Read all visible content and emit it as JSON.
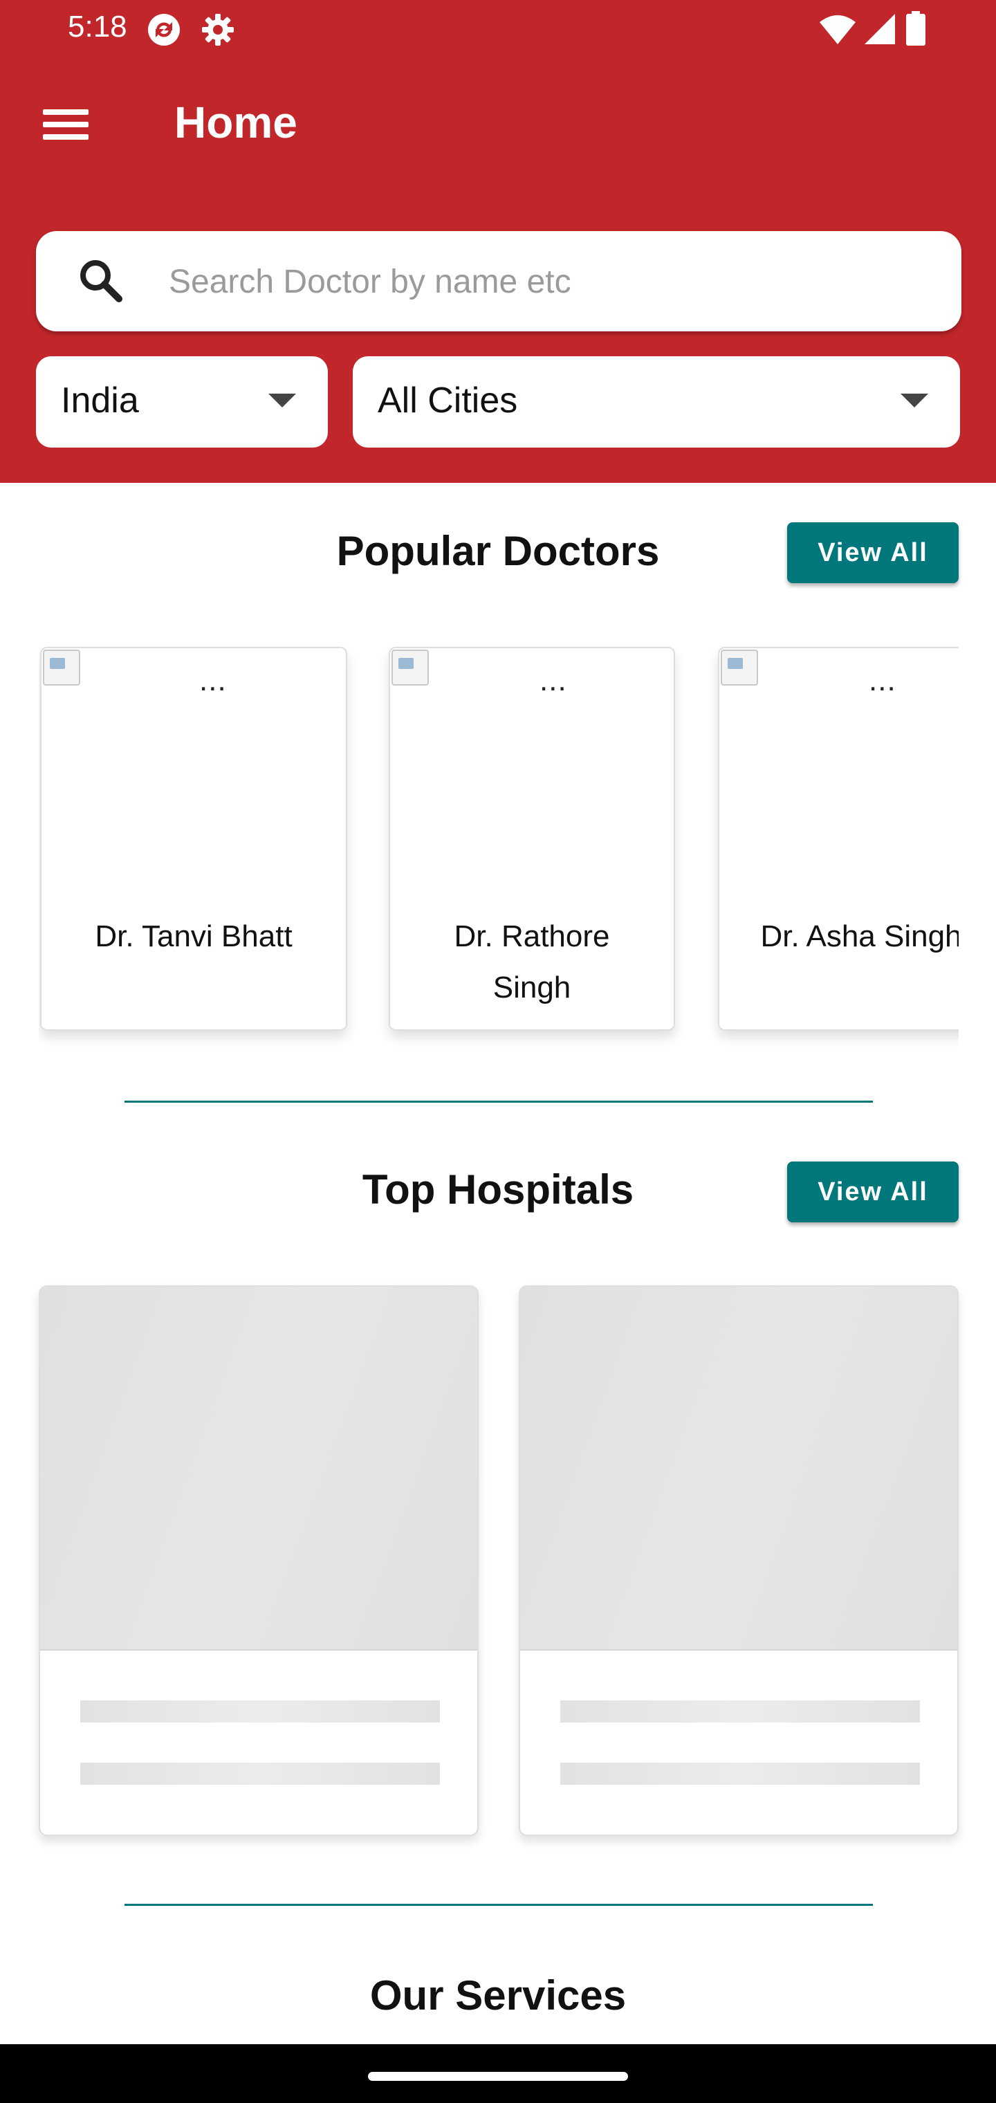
{
  "status_bar": {
    "time": "5:18",
    "icons": [
      "sync-icon",
      "gear-icon",
      "wifi-icon",
      "signal-icon",
      "battery-icon"
    ]
  },
  "app_bar": {
    "title": "Home",
    "menu_icon": "hamburger-menu-icon"
  },
  "search": {
    "placeholder": "Search Doctor by name etc",
    "icon": "search-icon"
  },
  "filters": {
    "country": {
      "selected": "India"
    },
    "city": {
      "selected": "All Cities"
    }
  },
  "popular_doctors": {
    "title": "Popular Doctors",
    "view_all_label": "View All",
    "doctors": [
      {
        "name": "Dr. Tanvi Bhatt",
        "image_alt": "..."
      },
      {
        "name": "Dr. Rathore Singh",
        "image_alt": "..."
      },
      {
        "name": "Dr. Asha Singh",
        "image_alt": "..."
      }
    ]
  },
  "top_hospitals": {
    "title": "Top Hospitals",
    "view_all_label": "View All",
    "loading_placeholders": 2
  },
  "our_services": {
    "title": "Our Services"
  },
  "colors": {
    "primary": "#c0262a",
    "accent": "#00777a",
    "background": "#ffffff"
  }
}
